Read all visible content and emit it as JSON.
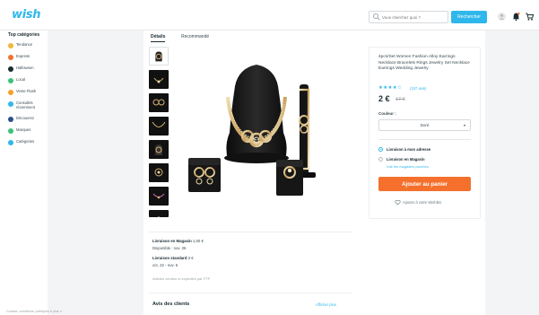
{
  "header": {
    "logo": "wish",
    "search_placeholder": "Vous cherchez quoi ?",
    "search_button": "Rechercher"
  },
  "sidebar": {
    "title": "Top catégories",
    "items": [
      {
        "label": "Tendance",
        "icon": "star-icon",
        "color": "#f2b63a"
      },
      {
        "label": "Express",
        "icon": "lightning-icon",
        "color": "#f4702c"
      },
      {
        "label": "Halloween",
        "icon": "bat-icon",
        "color": "#192a32"
      },
      {
        "label": "Local",
        "icon": "pin-icon",
        "color": "#39c27b"
      },
      {
        "label": "Vente Flash",
        "icon": "flash-icon",
        "color": "#f7a12a"
      },
      {
        "label": "Consultés récemment",
        "icon": "clock-icon",
        "color": "#2fb7ec"
      },
      {
        "label": "Découvrez",
        "icon": "compass-icon",
        "color": "#2d4e8a"
      },
      {
        "label": "Marques",
        "icon": "check-badge-icon",
        "color": "#39c27b"
      },
      {
        "label": "Catégories",
        "icon": "grid-icon",
        "color": "#2fb7ec"
      }
    ]
  },
  "footer": {
    "links": "Contact, conditions, politiques & plus ∨"
  },
  "tabs": {
    "details": "Détails",
    "recommended": "Recommandé"
  },
  "product": {
    "title": "4pcs/Set Women Fashion Alloy Earrings Necklace Bracelets Rings Jewelry Set Necklace Earrings Wedding Jewelry",
    "stars": "★★★★☆",
    "rating": 4,
    "reviews": "(157 avis)",
    "price": "2 €",
    "old_price": "17 €",
    "color_label": "Couleur :",
    "color_value": "Doré"
  },
  "shipping": {
    "home": "Livraison à mon adresse",
    "store": "Livraison en Magasin",
    "store_link": "Voir les magasins proches",
    "add_to_cart": "Ajouter au panier",
    "wishlist": "Ajouter à votre Wishlist"
  },
  "delivery": {
    "store_label": "Livraison en Magasin",
    "store_price": "1,60 €",
    "store_available": "Disponible : nov. 26",
    "standard_label": "Livraison standard",
    "standard_price": "3 €",
    "standard_dates": "oct. 22 - nov. 6",
    "sold_by": "Articles vendus et expédiés par FTP"
  },
  "reviews_section": {
    "title": "Avis des clients",
    "see_more": "Afficher plus"
  },
  "colors": {
    "accent": "#2fb7ec",
    "cta": "#f4702c"
  }
}
